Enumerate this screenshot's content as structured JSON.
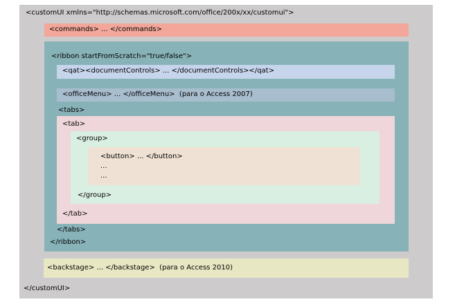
{
  "diagram": {
    "colors": {
      "customui": "#cdcbcb",
      "commands": "#f2a79a",
      "ribbon": "#87b3b8",
      "qat": "#c6d4ec",
      "officemenu": "#a8bdcd",
      "tab": "#efd6db",
      "group": "#d9efe2",
      "button": "#efe2d4",
      "backstage": "#e8e7c3"
    },
    "customui": {
      "open": "<customUI xmlns=\"http://schemas.microsoft.com/office/200x/xx/customui\">",
      "close": "</customUI>"
    },
    "commands": {
      "text": "<commands> ... </commands>"
    },
    "ribbon": {
      "open": "<ribbon startFromScratch=\"true/false\">",
      "close": "</ribbon>"
    },
    "qat": {
      "text": "<qat><documentControls> ... </documentControls></qat>"
    },
    "officemenu": {
      "text": "<officeMenu> ... </officeMenu>  (para o Access 2007)"
    },
    "tabs": {
      "open": "<tabs>",
      "close": "</tabs>"
    },
    "tab": {
      "open": "<tab>",
      "close": "</tab>"
    },
    "group": {
      "open": "<group>",
      "close": "</group>"
    },
    "button": {
      "line1": "<button> ... </button>",
      "line2": "...",
      "line3": "..."
    },
    "backstage": {
      "text": "<backstage> ... </backstage>  (para o Access 2010)"
    }
  }
}
